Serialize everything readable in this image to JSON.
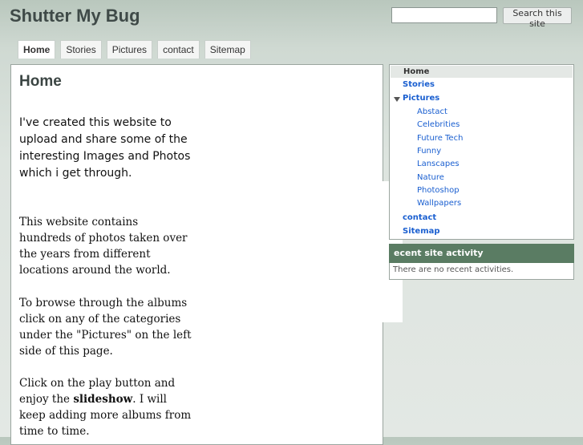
{
  "site": {
    "title": "Shutter My Bug"
  },
  "search": {
    "placeholder": "",
    "button_label": "Search this site"
  },
  "tabs": [
    {
      "label": "Home",
      "active": true
    },
    {
      "label": "Stories"
    },
    {
      "label": "Pictures"
    },
    {
      "label": "contact"
    },
    {
      "label": "Sitemap"
    }
  ],
  "main": {
    "title": "Home",
    "intro": "I've created this website to upload and share some of the interesting Images and Photos which i get through.",
    "paragraph2": "This website contains hundreds of photos taken over the years from different locations around the world.",
    "paragraph3": "To browse through the albums click on any of the categories under the \"Pictures\" on the left side of this page.",
    "paragraph4_before": "Click on the play button  and enjoy the ",
    "paragraph4_bold": "slideshow",
    "paragraph4_after": ". I will keep adding more albums from time to time."
  },
  "nav": {
    "home": "Home",
    "stories": "Stories",
    "pictures": "Pictures",
    "pictures_items": [
      "Abstact",
      "Celebrities",
      "Future Tech",
      "Funny",
      "Lanscapes",
      "Nature",
      "Photoshop",
      "Wallpapers"
    ],
    "contact": "contact",
    "sitemap": "Sitemap"
  },
  "activity": {
    "title": "ecent site activity",
    "empty_text": "There are no recent activities."
  },
  "colors": {
    "accent_green": "#5a7c63",
    "link_blue": "#1a5fd0"
  }
}
